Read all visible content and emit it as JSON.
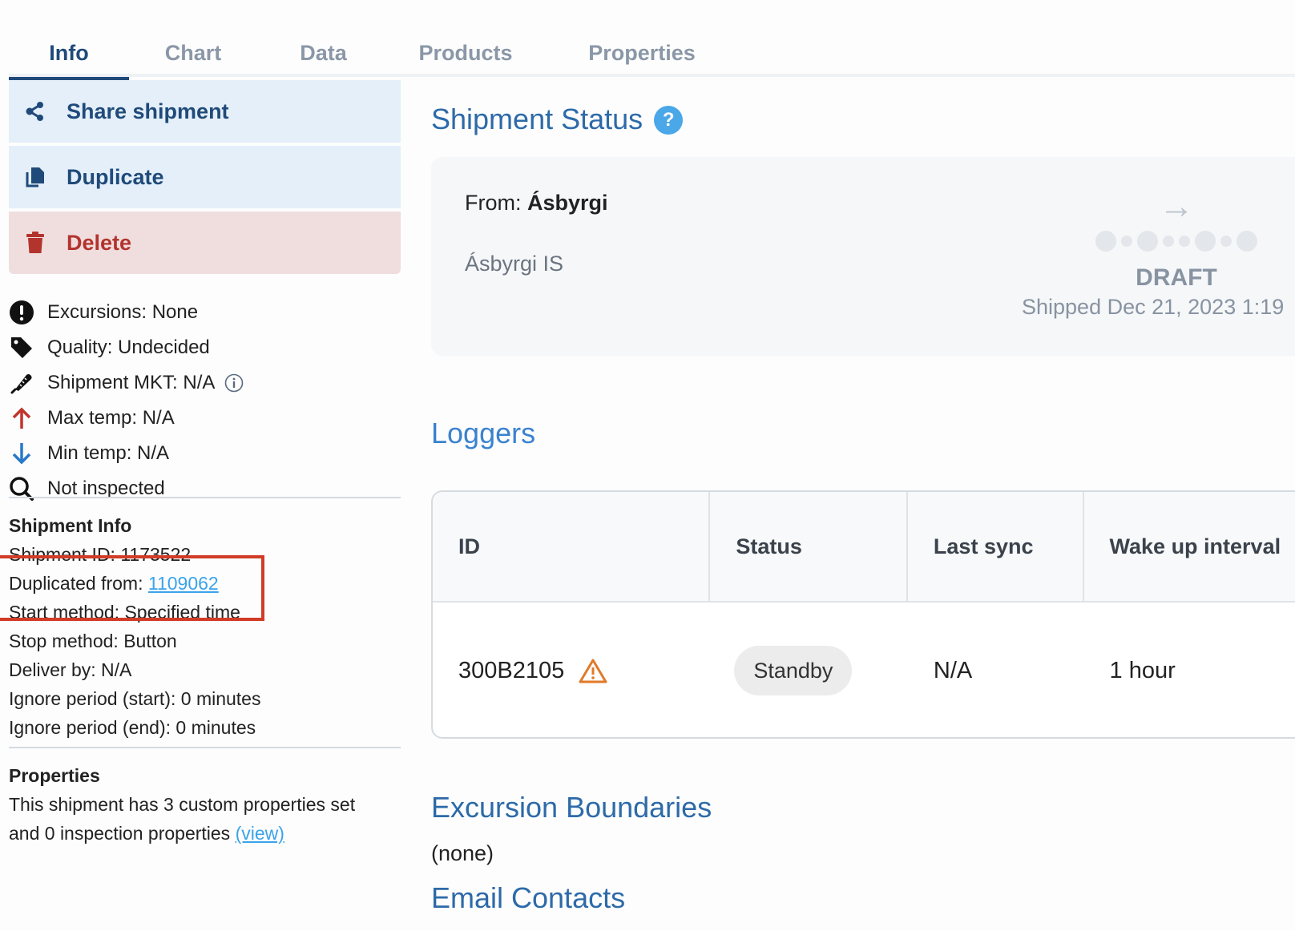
{
  "tabs": [
    {
      "label": "Info",
      "active": true
    },
    {
      "label": "Chart",
      "active": false
    },
    {
      "label": "Data",
      "active": false
    },
    {
      "label": "Products",
      "active": false
    },
    {
      "label": "Properties",
      "active": false
    }
  ],
  "actions": {
    "share": "Share shipment",
    "duplicate": "Duplicate",
    "delete": "Delete"
  },
  "stats": {
    "excursions": "Excursions: None",
    "quality": "Quality: Undecided",
    "mkt": "Shipment MKT: N/A",
    "max_temp": "Max temp: N/A",
    "min_temp": "Min temp: N/A",
    "inspection": "Not inspected"
  },
  "shipment_info": {
    "heading": "Shipment Info",
    "shipment_id_label": "Shipment ID: ",
    "shipment_id": "1173522",
    "duplicated_from_label": "Duplicated from: ",
    "duplicated_from": "1109062",
    "start_method": "Start method: Specified time",
    "stop_method": "Stop method: Button",
    "deliver_by": "Deliver by: N/A",
    "ignore_start": "Ignore period (start): 0 minutes",
    "ignore_end": "Ignore period (end): 0 minutes"
  },
  "properties": {
    "heading": "Properties",
    "line1": "This shipment has 3 custom properties set",
    "line2": "and 0 inspection properties ",
    "view_link": "(view)"
  },
  "shipment_status": {
    "title": "Shipment Status",
    "help": "?",
    "from_label": "From: ",
    "from_name": "Ásbyrgi",
    "from_sub": "Ásbyrgi IS",
    "arrow": "→",
    "state": "DRAFT",
    "shipped": "Shipped Dec 21, 2023 1:19"
  },
  "loggers": {
    "title": "Loggers",
    "columns": [
      "ID",
      "Status",
      "Last sync",
      "Wake up interval"
    ],
    "rows": [
      {
        "id": "300B2105",
        "warning": true,
        "status": "Standby",
        "last_sync": "N/A",
        "wake_up": "1 hour"
      }
    ]
  },
  "excursion_boundaries": {
    "title": "Excursion Boundaries",
    "value": "(none)"
  },
  "email_contacts": {
    "title": "Email Contacts"
  },
  "colors": {
    "primary": "#1f4a7a",
    "heading_blue": "#2d6aa8",
    "danger": "#b3332d",
    "link": "#3aa3ea",
    "highlight_box": "#d13c27",
    "warning": "#e07a2a"
  }
}
